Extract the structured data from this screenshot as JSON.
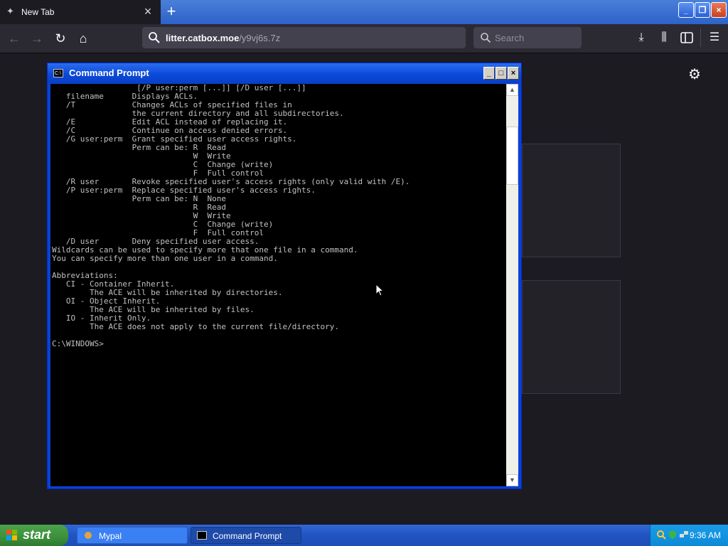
{
  "browser": {
    "tab": {
      "title": "New Tab"
    },
    "url": {
      "host": "litter.catbox.moe",
      "path": "/y9vj6s.7z"
    },
    "search": {
      "placeholder": "Search"
    }
  },
  "cmd": {
    "title": "Command Prompt",
    "lines": [
      "                  [/P user:perm [...]] [/D user [...]]",
      "   filename      Displays ACLs.",
      "   /T            Changes ACLs of specified files in",
      "                 the current directory and all subdirectories.",
      "   /E            Edit ACL instead of replacing it.",
      "   /C            Continue on access denied errors.",
      "   /G user:perm  Grant specified user access rights.",
      "                 Perm can be: R  Read",
      "                              W  Write",
      "                              C  Change (write)",
      "                              F  Full control",
      "   /R user       Revoke specified user's access rights (only valid with /E).",
      "   /P user:perm  Replace specified user's access rights.",
      "                 Perm can be: N  None",
      "                              R  Read",
      "                              W  Write",
      "                              C  Change (write)",
      "                              F  Full control",
      "   /D user       Deny specified user access.",
      "Wildcards can be used to specify more that one file in a command.",
      "You can specify more than one user in a command.",
      "",
      "Abbreviations:",
      "   CI - Container Inherit.",
      "        The ACE will be inherited by directories.",
      "   OI - Object Inherit.",
      "        The ACE will be inherited by files.",
      "   IO - Inherit Only.",
      "        The ACE does not apply to the current file/directory.",
      "",
      "C:\\WINDOWS>"
    ]
  },
  "taskbar": {
    "start_label": "start",
    "tasks": [
      {
        "label": "Mypal"
      },
      {
        "label": "Command Prompt"
      }
    ],
    "clock": "9:36 AM"
  },
  "icons": {
    "tab_favicon": "firefox-icon",
    "back": "back-arrow-icon",
    "forward": "forward-arrow-icon",
    "reload": "reload-icon",
    "home": "home-icon",
    "downloads": "download-icon",
    "library": "library-icon",
    "sidebar": "sidebar-icon",
    "menu": "hamburger-menu-icon",
    "settings": "gear-icon"
  }
}
